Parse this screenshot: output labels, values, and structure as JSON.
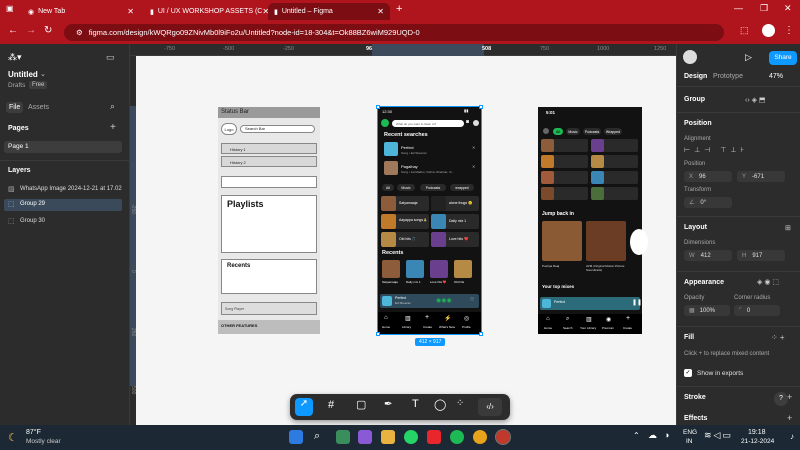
{
  "browser": {
    "tabs": [
      {
        "title": "New Tab"
      },
      {
        "title": "UI / UX WORKSHOP ASSETS (C"
      },
      {
        "title": "Untitled – Figma"
      }
    ],
    "url": "figma.com/design/kWQRgo09ZNivMb0l9iFo2u/Untitled?node-id=18-304&t=Ok88BZ6wiM929UQD-0"
  },
  "left": {
    "file_title": "Untitled",
    "drafts": "Drafts",
    "plan": "Free",
    "tabs": [
      "File",
      "Assets"
    ],
    "pages_heading": "Pages",
    "page": "Page 1",
    "layers_heading": "Layers",
    "layers": [
      "WhatsApp Image 2024-12-21 at 17.02",
      "Group 29",
      "Group 30"
    ]
  },
  "ruler": {
    "top": [
      "-750",
      "-500",
      "-250",
      "96",
      "508",
      "750",
      "1000",
      "1250"
    ],
    "left": [
      "-250",
      "0",
      "250",
      "500"
    ]
  },
  "right": {
    "tabs": [
      "Design",
      "Prototype"
    ],
    "zoom": "47%",
    "share": "Share",
    "group_label": "Group",
    "position": "Position",
    "alignment": "Alignment",
    "pos_label": "Position",
    "x_label": "X",
    "x": "96",
    "y_label": "Y",
    "y": "-671",
    "transform": "Transform",
    "rotation": "0°",
    "layout": "Layout",
    "dimensions": "Dimensions",
    "w_label": "W",
    "w": "412",
    "h_label": "H",
    "h": "917",
    "appearance": "Appearance",
    "opacity_label": "Opacity",
    "opacity": "100%",
    "radius_label": "Corner radius",
    "radius": "0",
    "fill": "Fill",
    "fill_hint": "Click + to replace mixed content",
    "show_exports": "Show in exports",
    "stroke": "Stroke",
    "effects": "Effects",
    "help": "?"
  },
  "canvas": {
    "size_badge": "412 × 917",
    "wire": {
      "status": "Status Bar",
      "logo": "Logo",
      "search": "Search Bar",
      "history1": "History 1",
      "history2": "History 2",
      "playlists": "Playlists",
      "recents": "Recents",
      "songplayer": "Song Player",
      "other": "OTHER FEATURES"
    },
    "phone1": {
      "time": "12:30",
      "search_placeholder": "What do you want to listen to?",
      "recent_heading": "Recent searches",
      "r1_title": "Perfect",
      "r1_sub": "Song • Ed Sheeran",
      "r2_title": "Pagalhay",
      "r2_sub": "Song • Jai Madhu, Vishnu Shankar, Vi...",
      "chips": [
        "All",
        "Music",
        "Podcasts",
        "wrapped"
      ],
      "tiles": [
        "Satyamaaja",
        "alone thugs 😊",
        "Aayappa songs🙏",
        "Daily mix 1",
        "Old hits 🎵",
        "Love hits ❤️"
      ],
      "recents_heading": "Recents",
      "recents": [
        "Satyamaaja",
        "Daily mix 1",
        "Love hits ❤️",
        "Old hits"
      ],
      "player_title": "Perfect",
      "player_artist": "Ed Sheeran",
      "nav": [
        "Home",
        "Library",
        "Create",
        "What's New",
        "Profile"
      ]
    },
    "phone2": {
      "time": "5:01",
      "chips": [
        "All",
        "Music",
        "Podcasts",
        "Wrapped"
      ],
      "jump_heading": "Jump back in",
      "j1": "Pushpa Raaj",
      "j2": "AVM (Original Motion Picture Soundtrack)",
      "top_mixes": "Your top mixes",
      "player_title": "Perfect",
      "nav": [
        "Home",
        "Search",
        "Your Library",
        "Premium",
        "Create"
      ]
    }
  },
  "toolbar": {
    "tools": [
      "move-tool",
      "frame-tool",
      "shape-tool",
      "pen-tool",
      "text-tool",
      "comment-tool",
      "assets-tool",
      "dev-mode-tool"
    ]
  },
  "taskbar": {
    "temp": "87°F",
    "weather": "Mostly clear",
    "lang1": "ENG",
    "lang2": "IN",
    "time": "19:18",
    "date": "21-12-2024"
  },
  "colors": {
    "accent": "#0d99ff",
    "spotify_green": "#1db954",
    "browser_red": "#b0151e"
  }
}
